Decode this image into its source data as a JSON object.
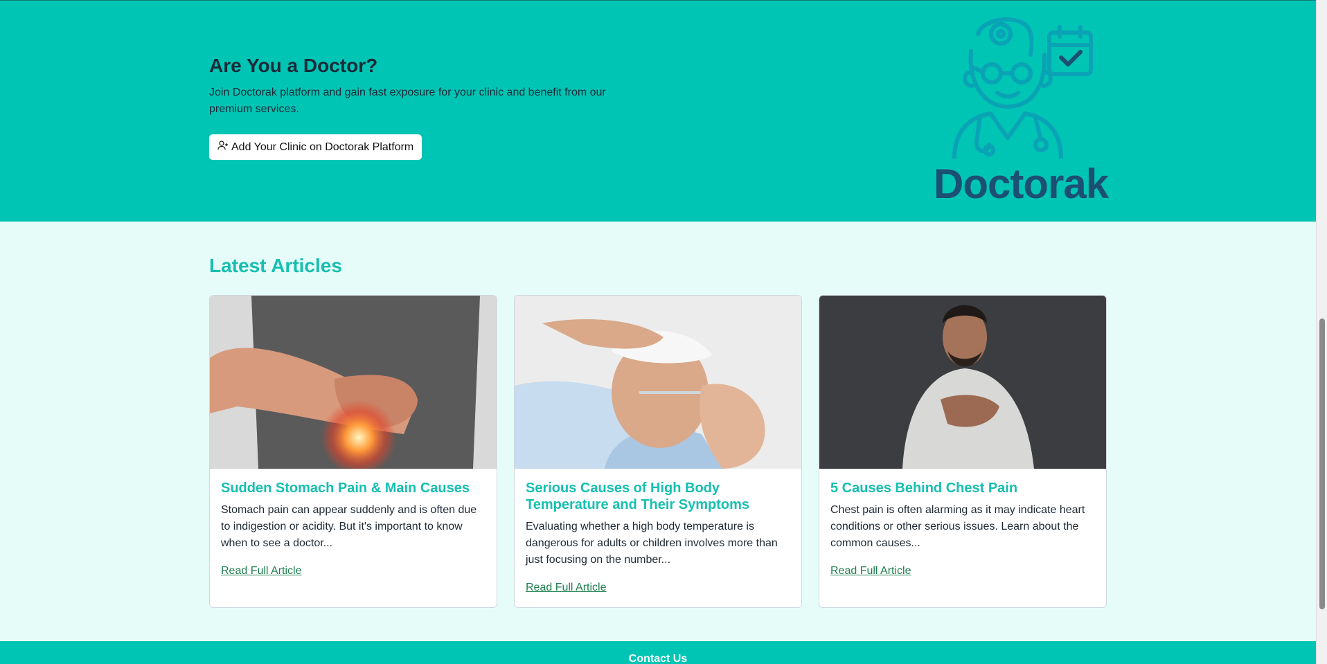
{
  "hero": {
    "title": "Are You a Doctor?",
    "description": "Join Doctorak platform and gain fast exposure for your clinic and benefit from our premium services.",
    "button_label": "Add Your Clinic on Doctorak Platform",
    "button_icon": "user-plus-icon",
    "logo_text": "Doctorak",
    "colors": {
      "background": "#00c4b4",
      "logo": "#1c4f74",
      "logo_outline": "#0aa3b6"
    }
  },
  "articles": {
    "section_title": "Latest Articles",
    "items": [
      {
        "title": "Sudden Stomach Pain & Main Causes",
        "excerpt": "Stomach pain can appear suddenly and is often due to indigestion or acidity. But it's important to know when to see a doctor...",
        "link_label": "Read Full Article"
      },
      {
        "title": "Serious Causes of High Body Temperature and Their Symptoms",
        "excerpt": "Evaluating whether a high body temperature is dangerous for adults or children involves more than just focusing on the number...",
        "link_label": "Read Full Article"
      },
      {
        "title": "5 Causes Behind Chest Pain",
        "excerpt": "Chest pain is often alarming as it may indicate heart conditions or other serious issues. Learn about the common causes...",
        "link_label": "Read Full Article"
      }
    ]
  },
  "footer": {
    "title": "Contact Us"
  }
}
